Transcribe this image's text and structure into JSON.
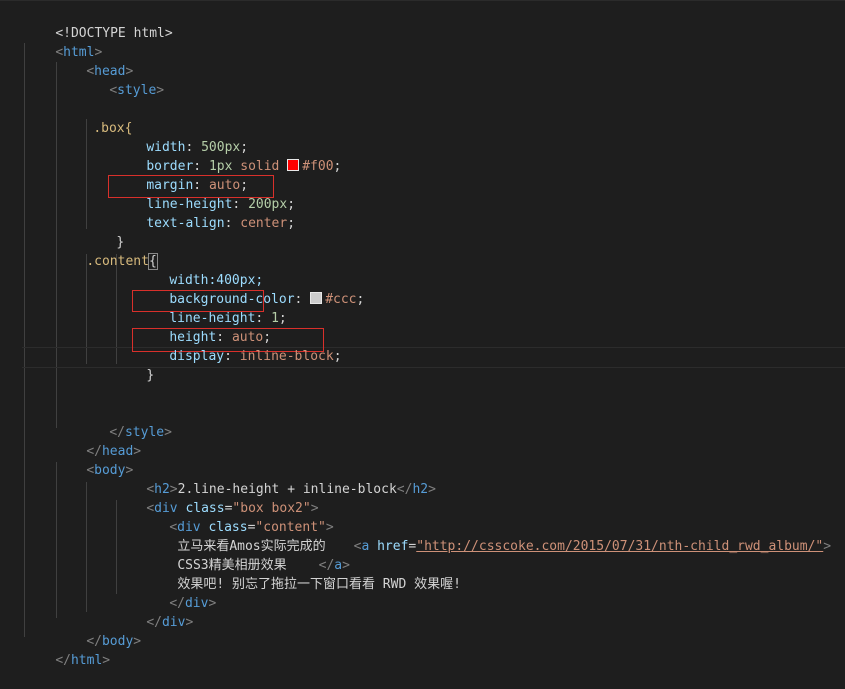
{
  "colors": {
    "red_swatch": "#ff0000",
    "gray_swatch": "#cccccc"
  },
  "code": {
    "l1": "<!DOCTYPE html>",
    "html_tag": "html",
    "head_tag": "head",
    "style_tag": "style",
    "box_sel": ".box{",
    "width_prop": "width",
    "width_val": "500px",
    "border_prop": "border",
    "border_num": "1px",
    "border_style": "solid",
    "border_color": "#f00",
    "margin_prop": "margin",
    "margin_val": "auto",
    "lh_prop": "line-height",
    "lh_val": "200px",
    "ta_prop": "text-align",
    "ta_val": "center",
    "close_brace": "}",
    "content_sel": ".content",
    "open_brace": "{",
    "width2": "width:400px;",
    "bg_prop": "background-color",
    "bg_val": "#ccc",
    "lh2_prop": "line-height",
    "lh2_val": "1",
    "h_prop": "height",
    "h_val": "auto",
    "disp_prop": "display",
    "disp_val": "inline-block",
    "style_close": "style",
    "head_close": "head",
    "body_tag": "body",
    "h2_tag": "h2",
    "h2_text": "2.line-height + inline-block",
    "div_tag": "div",
    "class_attr": "class",
    "box_class": "\"box box2\"",
    "content_class": "\"content\"",
    "text1": "立马来看Amos实际完成的",
    "a_tag": "a",
    "href_attr": "href",
    "href_val": "\"http://csscoke.com/2015/07/31/nth-child_rwd_album/\"",
    "text2": "CSS3精美相册效果",
    "text3": "效果吧! 别忘了拖拉一下窗口看看 RWD 效果喔!",
    "body_close": "body",
    "html_close": "html"
  }
}
